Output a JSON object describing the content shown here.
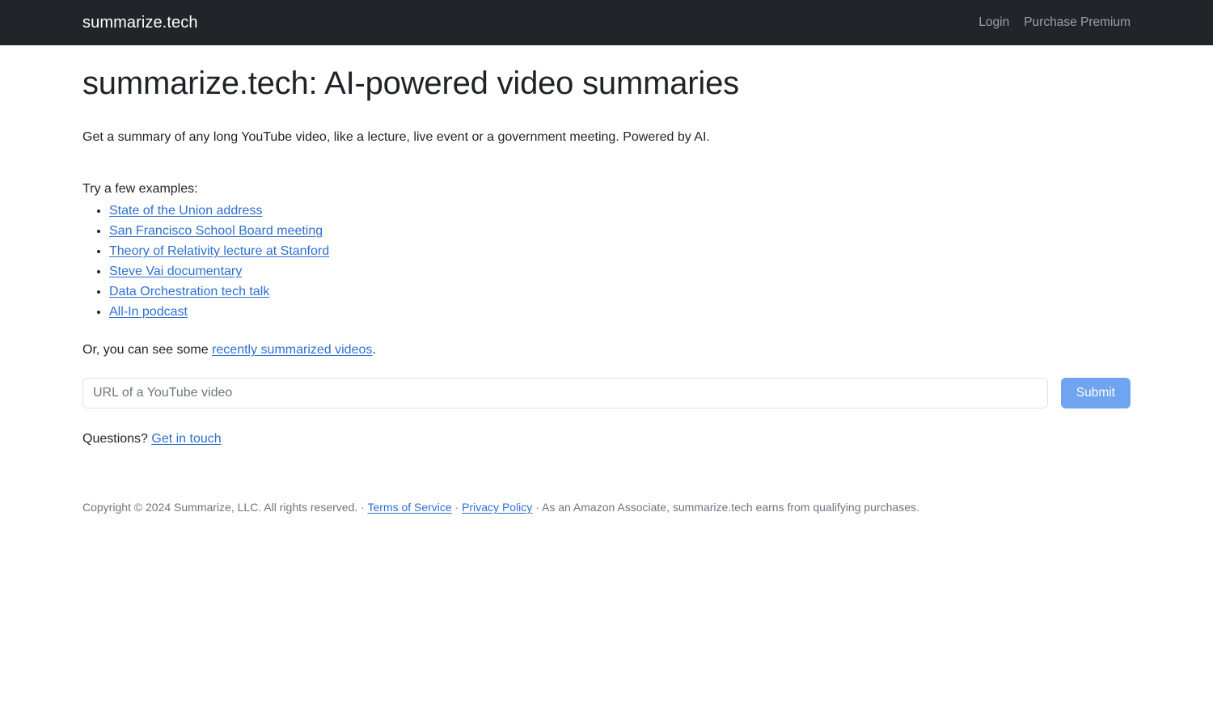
{
  "navbar": {
    "brand": "summarize.tech",
    "links": [
      {
        "label": "Login"
      },
      {
        "label": "Purchase Premium"
      }
    ]
  },
  "main": {
    "title": "summarize.tech: AI-powered video summaries",
    "lede": "Get a summary of any long YouTube video, like a lecture, live event or a government meeting. Powered by AI.",
    "examples_intro": "Try a few examples:",
    "examples": [
      {
        "label": "State of the Union address"
      },
      {
        "label": "San Francisco School Board meeting"
      },
      {
        "label": "Theory of Relativity lecture at Stanford"
      },
      {
        "label": "Steve Vai documentary"
      },
      {
        "label": "Data Orchestration tech talk"
      },
      {
        "label": "All-In podcast"
      }
    ],
    "recent": {
      "prefix": "Or, you can see some ",
      "link": "recently summarized videos",
      "suffix": "."
    },
    "form": {
      "placeholder": "URL of a YouTube video",
      "value": "",
      "submit_label": "Submit"
    },
    "questions": {
      "prefix": "Questions? ",
      "link": "Get in touch"
    }
  },
  "footer": {
    "copyright": "Copyright © 2024 Summarize, LLC. All rights reserved.",
    "sep1": "·",
    "terms": "Terms of Service",
    "sep2": "·",
    "privacy": "Privacy Policy",
    "sep3": "·",
    "amazon": "As an Amazon Associate, summarize.tech earns from qualifying purchases."
  },
  "colors": {
    "navbar_bg": "#212529",
    "link": "#2f6fd0",
    "submit_bg": "#6ea4f0",
    "muted": "#6c757d"
  }
}
